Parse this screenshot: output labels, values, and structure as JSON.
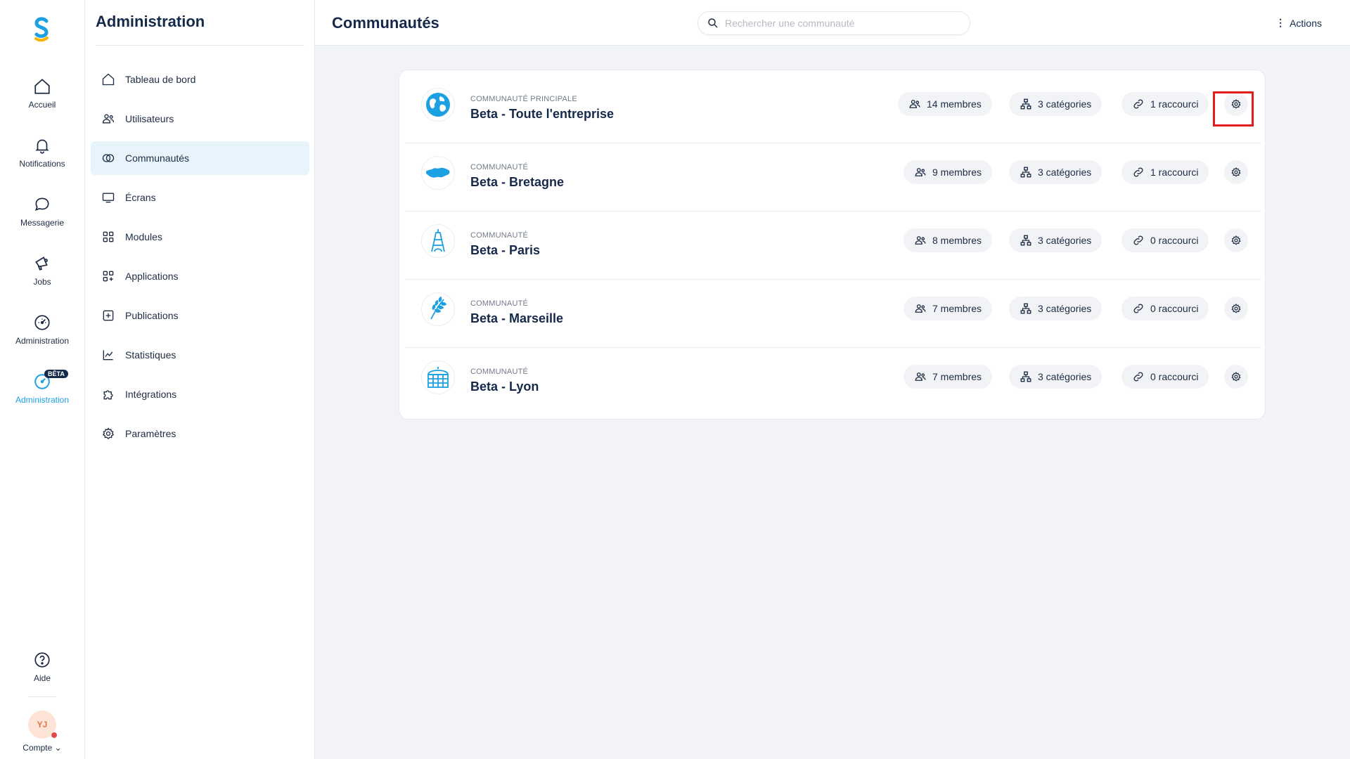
{
  "rail": {
    "items": [
      {
        "label": "Accueil",
        "icon": "home-icon"
      },
      {
        "label": "Notifications",
        "icon": "bell-icon"
      },
      {
        "label": "Messagerie",
        "icon": "chat-icon"
      },
      {
        "label": "Jobs",
        "icon": "megaphone-icon"
      },
      {
        "label": "Administration",
        "icon": "gauge-icon"
      },
      {
        "label": "Administration",
        "icon": "gauge-icon",
        "badge": "BÊTA",
        "active": true
      }
    ],
    "help_label": "Aide",
    "avatar_initials": "YJ",
    "account_label": "Compte ⌄"
  },
  "sidebar": {
    "title": "Administration",
    "items": [
      {
        "label": "Tableau de bord",
        "icon": "home-icon"
      },
      {
        "label": "Utilisateurs",
        "icon": "users-icon"
      },
      {
        "label": "Communautés",
        "icon": "rings-icon",
        "active": true
      },
      {
        "label": "Écrans",
        "icon": "monitor-icon"
      },
      {
        "label": "Modules",
        "icon": "grid-icon"
      },
      {
        "label": "Applications",
        "icon": "apps-add-icon"
      },
      {
        "label": "Publications",
        "icon": "plus-square-icon"
      },
      {
        "label": "Statistiques",
        "icon": "chart-icon"
      },
      {
        "label": "Intégrations",
        "icon": "puzzle-icon"
      },
      {
        "label": "Paramètres",
        "icon": "gear-icon"
      }
    ]
  },
  "header": {
    "title": "Communautés",
    "search_placeholder": "Rechercher une communauté",
    "actions_label": "Actions"
  },
  "communities": [
    {
      "kind": "Communauté principale",
      "name": "Beta - Toute l'entreprise",
      "icon": "globe-icon",
      "members": "14 membres",
      "categories": "3 catégories",
      "shortcuts": "1 raccourci"
    },
    {
      "kind": "Communauté",
      "name": "Beta - Bretagne",
      "icon": "bretagne-map-icon",
      "members": "9 membres",
      "categories": "3 catégories",
      "shortcuts": "1 raccourci"
    },
    {
      "kind": "Communauté",
      "name": "Beta - Paris",
      "icon": "eiffel-tower-icon",
      "members": "8 membres",
      "categories": "3 catégories",
      "shortcuts": "0 raccourci"
    },
    {
      "kind": "Communauté",
      "name": "Beta - Marseille",
      "icon": "wheat-icon",
      "members": "7 membres",
      "categories": "3 catégories",
      "shortcuts": "0 raccourci"
    },
    {
      "kind": "Communauté",
      "name": "Beta - Lyon",
      "icon": "building-icon",
      "members": "7 membres",
      "categories": "3 catégories",
      "shortcuts": "0 raccourci"
    }
  ],
  "colors": {
    "accent": "#1ba0e2",
    "title": "#15294b",
    "highlight": "#e41b1b"
  }
}
